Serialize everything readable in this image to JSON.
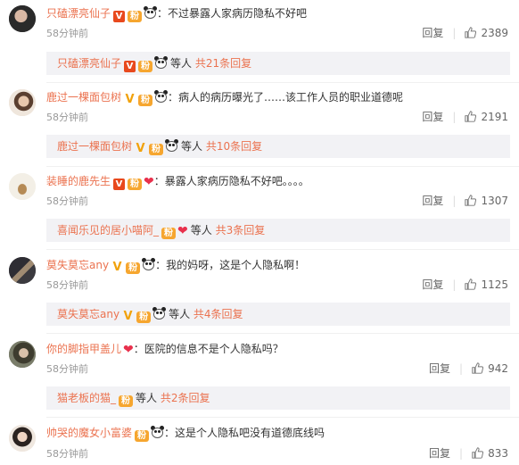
{
  "comments": [
    {
      "username": "只磕漂亮仙子",
      "text": "：不过暴露人家病历隐私不好吧",
      "time": "58分钟前",
      "reply_label": "回复",
      "likes": "2389",
      "badges": [
        "v-red",
        "club",
        "panda"
      ],
      "replies": {
        "username": "只磕漂亮仙子",
        "badges": [
          "v-red",
          "club",
          "panda"
        ],
        "suffix": "等人",
        "count_text": "共21条回复"
      }
    },
    {
      "username": "鹿过一棵面包树",
      "text": "：病人的病历曝光了……该工作人员的职业道德呢",
      "time": "58分钟前",
      "reply_label": "回复",
      "likes": "2191",
      "badges": [
        "v-gold",
        "club",
        "panda"
      ],
      "replies": {
        "username": "鹿过一棵面包树",
        "badges": [
          "v-gold",
          "club",
          "panda"
        ],
        "suffix": "等人",
        "count_text": "共10条回复"
      }
    },
    {
      "username": "装睡的鹿先生",
      "text": "：暴露人家病历隐私不好吧。。。。",
      "time": "58分钟前",
      "reply_label": "回复",
      "likes": "1307",
      "badges": [
        "v-red",
        "club",
        "heart"
      ],
      "replies": {
        "username": "喜闻乐见的居小喵阿_",
        "badges": [
          "club",
          "heart"
        ],
        "suffix": "等人",
        "count_text": "共3条回复"
      }
    },
    {
      "username": "莫失莫忘any",
      "text": "：我的妈呀，这是个人隐私啊！",
      "time": "58分钟前",
      "reply_label": "回复",
      "likes": "1125",
      "badges": [
        "v-gold",
        "club",
        "panda"
      ],
      "replies": {
        "username": "莫失莫忘any",
        "badges": [
          "v-gold",
          "club",
          "panda"
        ],
        "suffix": "等人",
        "count_text": "共4条回复"
      }
    },
    {
      "username": "你的脚指甲盖儿",
      "text": "：医院的信息不是个人隐私吗？",
      "time": "58分钟前",
      "reply_label": "回复",
      "likes": "942",
      "badges": [
        "heart"
      ],
      "replies": {
        "username": "猫老板的猫_",
        "badges": [
          "club"
        ],
        "suffix": "等人",
        "count_text": "共2条回复"
      }
    },
    {
      "username": "帅哭的魔女小富婆",
      "text": "：这是个人隐私吧没有道德底线吗",
      "time": "58分钟前",
      "reply_label": "回复",
      "likes": "833",
      "badges": [
        "club",
        "panda"
      ],
      "replies": null
    }
  ],
  "icons": {
    "like": "thumbs-up-icon",
    "panda": "panda-emoji-icon",
    "heart": "heart-icon",
    "verified": "verified-v-icon",
    "club": "fan-club-badge-icon"
  },
  "colors": {
    "username": "#eb7350",
    "reply_bg": "#f2f2f5",
    "meta": "#999999"
  }
}
